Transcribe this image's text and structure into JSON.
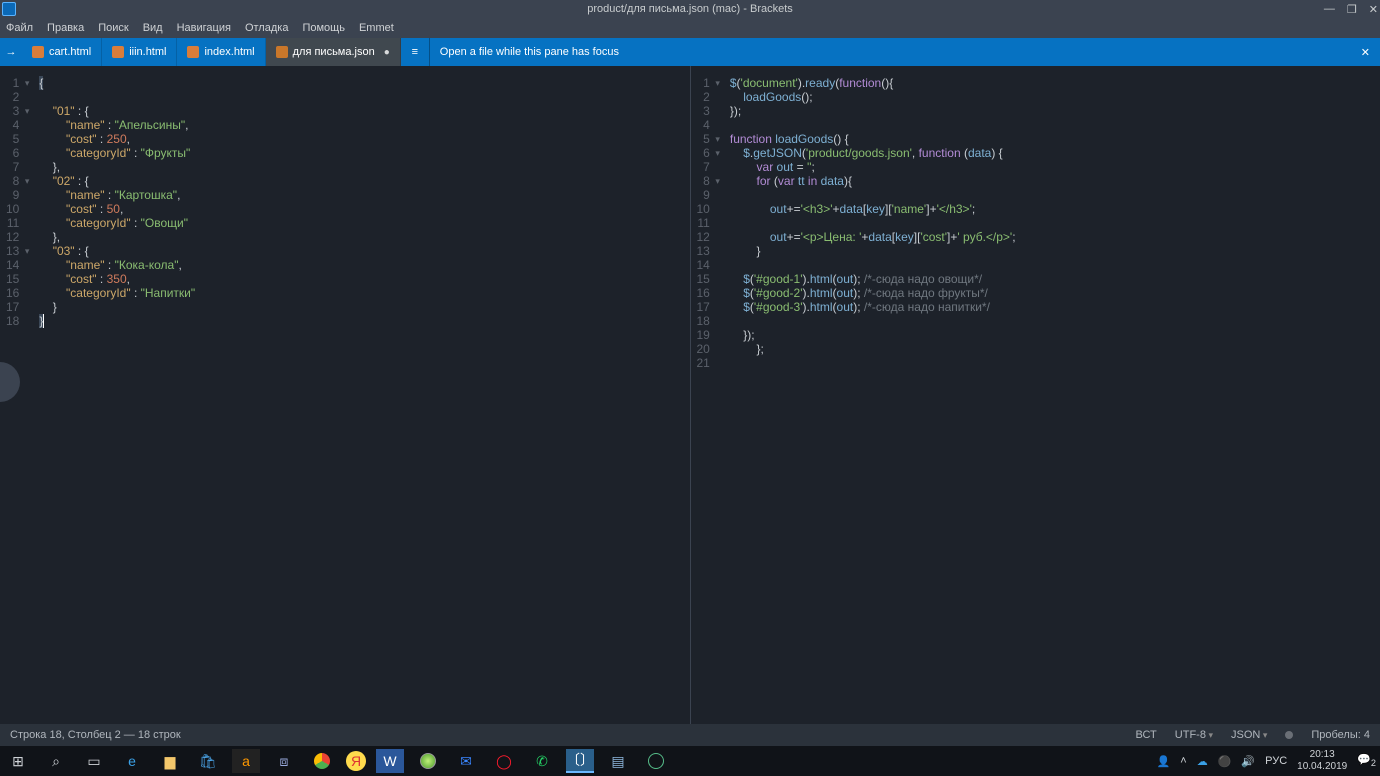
{
  "window": {
    "title": "product/для письма.json (mac) - Brackets"
  },
  "menu": [
    "Файл",
    "Правка",
    "Поиск",
    "Вид",
    "Навигация",
    "Отладка",
    "Помощь",
    "Emmet"
  ],
  "tabs": [
    {
      "label": "cart.html",
      "active": false
    },
    {
      "label": "iiin.html",
      "active": false
    },
    {
      "label": "index.html",
      "active": false
    },
    {
      "label": "для письма.json",
      "active": true
    }
  ],
  "secondPane": {
    "hint": "Open a file while this pane has focus"
  },
  "leftCode": {
    "lines": [
      {
        "n": 1,
        "fold": true
      },
      {
        "n": 2
      },
      {
        "n": 3,
        "fold": true
      },
      {
        "n": 4
      },
      {
        "n": 5
      },
      {
        "n": 6
      },
      {
        "n": 7
      },
      {
        "n": 8,
        "fold": true
      },
      {
        "n": 9
      },
      {
        "n": 10
      },
      {
        "n": 11
      },
      {
        "n": 12
      },
      {
        "n": 13,
        "fold": true
      },
      {
        "n": 14
      },
      {
        "n": 15
      },
      {
        "n": 16
      },
      {
        "n": 17
      },
      {
        "n": 18
      }
    ],
    "content_data": {
      "01": {
        "name": "Апельсины",
        "cost": 250,
        "categoryId": "Фрукты"
      },
      "02": {
        "name": "Картошка",
        "cost": 50,
        "categoryId": "Овощи"
      },
      "03": {
        "name": "Кока-кола",
        "cost": 350,
        "categoryId": "Напитки"
      }
    }
  },
  "rightCode": {
    "lines": [
      {
        "n": 1,
        "fold": true
      },
      {
        "n": 2
      },
      {
        "n": 3
      },
      {
        "n": 4
      },
      {
        "n": 5,
        "fold": true
      },
      {
        "n": 6,
        "fold": true
      },
      {
        "n": 7
      },
      {
        "n": 8,
        "fold": true
      },
      {
        "n": 9
      },
      {
        "n": 10
      },
      {
        "n": 11
      },
      {
        "n": 12
      },
      {
        "n": 13
      },
      {
        "n": 14
      },
      {
        "n": 15
      },
      {
        "n": 16
      },
      {
        "n": 17
      },
      {
        "n": 18
      },
      {
        "n": 19
      },
      {
        "n": 20
      },
      {
        "n": 21
      }
    ],
    "strings": {
      "doc": "'document'",
      "gjson": "'product/goods.json'",
      "empty": "''",
      "h3o": "'<h3>'",
      "h3c": "'</h3>'",
      "name": "'name'",
      "cost": "'cost'",
      "price": "'<p>Цена: '",
      "rub": "' руб.</p>'",
      "g1": "'#good-1'",
      "g2": "'#good-2'",
      "g3": "'#good-3'",
      "c1": "/*-сюда надо овощи*/",
      "c2": "/*-сюда надо фрукты*/",
      "c3": "/*-сюда надо напитки*/"
    }
  },
  "status": {
    "left": "Строка 18, Столбец 2 — 18 строк",
    "right": [
      "ВСТ",
      "UTF-8",
      "JSON",
      "Пробелы: 4"
    ]
  },
  "tray": {
    "lang": "РУС",
    "time": "20:13",
    "date": "10.04.2019",
    "notif": "2"
  }
}
